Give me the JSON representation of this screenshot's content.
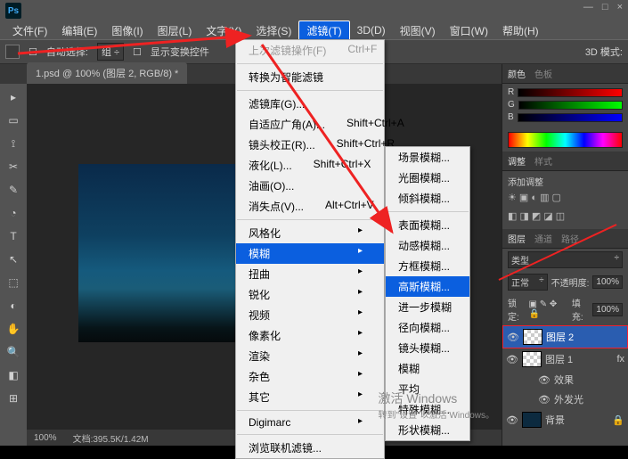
{
  "menus": [
    "文件(F)",
    "编辑(E)",
    "图像(I)",
    "图层(L)",
    "文字(Y)",
    "选择(S)",
    "滤镜(T)",
    "3D(D)",
    "视图(V)",
    "窗口(W)",
    "帮助(H)"
  ],
  "menu_hl_index": 6,
  "optbar": {
    "auto_select": "自动选择:",
    "group": "组",
    "show_transform": "显示变换控件",
    "mode3d": "3D 模式:"
  },
  "doc_tab": "1.psd @ 100% (图层 2, RGB/8) *",
  "filter_menu": {
    "last": {
      "label": "上次滤镜操作(F)",
      "shortcut": "Ctrl+F"
    },
    "smart": "转换为智能滤镜",
    "gallery": "滤镜库(G)...",
    "adaptive": {
      "label": "自适应广角(A)...",
      "shortcut": "Shift+Ctrl+A"
    },
    "lens": {
      "label": "镜头校正(R)...",
      "shortcut": "Shift+Ctrl+R"
    },
    "liquify": {
      "label": "液化(L)...",
      "shortcut": "Shift+Ctrl+X"
    },
    "oil": "油画(O)...",
    "vanish": {
      "label": "消失点(V)...",
      "shortcut": "Alt+Ctrl+V"
    },
    "subs": [
      "风格化",
      "模糊",
      "扭曲",
      "锐化",
      "视频",
      "像素化",
      "渲染",
      "杂色",
      "其它"
    ],
    "digimarc": "Digimarc",
    "browse": "浏览联机滤镜..."
  },
  "blur_menu": [
    "场景模糊...",
    "光圈模糊...",
    "倾斜模糊...",
    "表面模糊...",
    "动感模糊...",
    "方框模糊...",
    "高斯模糊...",
    "进一步模糊",
    "径向模糊...",
    "镜头模糊...",
    "模糊",
    "平均",
    "特殊模糊...",
    "形状模糊..."
  ],
  "blur_hl_index": 6,
  "panels": {
    "color_tabs": [
      "颜色",
      "色板"
    ],
    "rgb": {
      "r": "R",
      "g": "G",
      "b": "B"
    },
    "adj_tabs": [
      "调整",
      "样式"
    ],
    "adj_title": "添加调整",
    "layer_tabs": [
      "图层",
      "通道",
      "路径"
    ],
    "kind": "类型",
    "blend": "正常",
    "opacity_label": "不透明度:",
    "opacity_val": "100%",
    "lock_label": "锁定:",
    "fill_label": "填充:",
    "fill_val": "100%",
    "layers": [
      "图层 2",
      "图层 1",
      "效果",
      "外发光",
      "背景"
    ]
  },
  "status": {
    "zoom": "100%",
    "info": "文档:395.5K/1.42M"
  },
  "watermark": {
    "line1": "激活 Windows",
    "line2": "转到\"设置\"以激活 Windows。"
  },
  "win": {
    "min": "—",
    "max": "□",
    "close": "×"
  }
}
